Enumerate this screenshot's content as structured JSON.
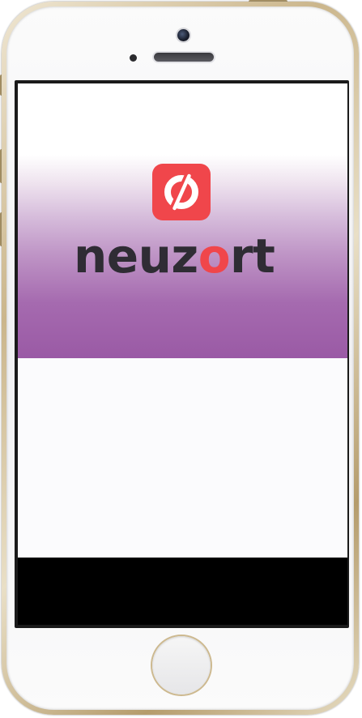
{
  "app": {
    "brand_prefix": "neuz",
    "brand_o": "o",
    "brand_suffix": "rt",
    "icon": "neuzort-logo-icon"
  },
  "colors": {
    "accent_red": "#f0464b",
    "brand_text": "#2f2c34",
    "hero_gradient_top": "#ffffff",
    "hero_gradient_bottom": "#9a5aa5",
    "bottom_bar": "#000000",
    "phone_frame_gold": "#cbb68c"
  },
  "device": {
    "type": "phone-mockup",
    "color": "gold-white"
  }
}
